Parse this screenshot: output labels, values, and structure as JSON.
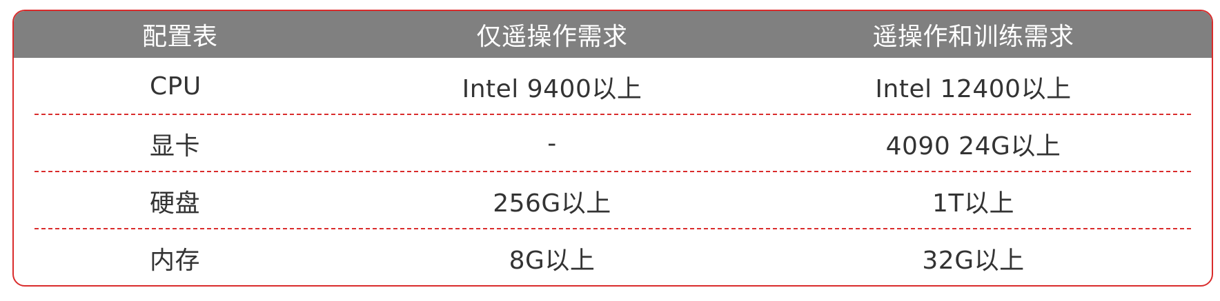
{
  "table": {
    "headers": [
      "配置表",
      "仅遥操作需求",
      "遥操作和训练需求"
    ],
    "rows": [
      [
        "CPU",
        "Intel 9400以上",
        "Intel 12400以上"
      ],
      [
        "显卡",
        "-",
        "4090 24G以上"
      ],
      [
        "硬盘",
        "256G以上",
        "1T以上"
      ],
      [
        "内存",
        "8G以上",
        "32G以上"
      ]
    ]
  },
  "colors": {
    "border": "#d92b2b",
    "header_bg": "#808080",
    "header_text": "#ffffff",
    "body_text": "#333333"
  }
}
